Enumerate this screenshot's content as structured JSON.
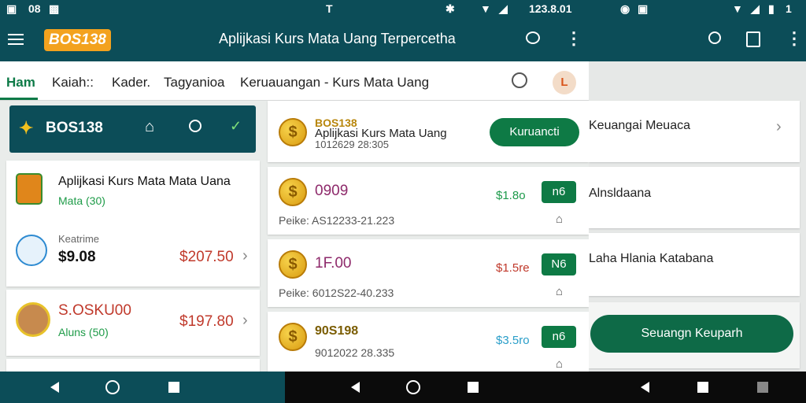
{
  "status_left": {
    "icons": [
      "n-icon",
      "photo-icon"
    ],
    "text": "08"
  },
  "status_mid": {
    "text": "T",
    "time": "123.8.01"
  },
  "status_right": {
    "text": "1"
  },
  "brand": {
    "logo_text": "BOS138"
  },
  "appbar": {
    "title": "Aplijkasi Kurs Mata Uang Terpercetha"
  },
  "tabs": [
    {
      "label": "Ham",
      "active": true
    },
    {
      "label": "Kaiah::"
    },
    {
      "label": "Kader."
    },
    {
      "label": "Tagyanioa"
    },
    {
      "label": "Keruauangan - Kurs Mata Uang"
    }
  ],
  "avatar_letter": "L",
  "panel_left": {
    "header_logo": "BOS138",
    "card1": {
      "title": "Aplijkasi Kurs Mata Mata Uana",
      "sub": "Mata (30)"
    },
    "card2": {
      "caption": "Keatrime",
      "value": "$9.08",
      "amount": "$207.50"
    },
    "card3": {
      "title": "S.OSKU00",
      "sub": "Aluns (50)",
      "amount": "$197.80"
    }
  },
  "panel_center": {
    "top": {
      "brand": "BOS138",
      "title": "Aplijkasi Kurs Mata Uang",
      "sub": "1012629 28:305",
      "button": "Kuruancti"
    },
    "rows": [
      {
        "name": "0909",
        "rate": "$1.8o",
        "badge": "n6",
        "pair": "Peike: AS12233-21.223",
        "rate_color": "#1d9a4b",
        "name_color": "#8e2a6b"
      },
      {
        "name": "1F.00",
        "rate": "$1.5re",
        "badge": "N6",
        "pair": "Peike: 6012S22-40.233",
        "rate_color": "#c0392b",
        "name_color": "#8e2a6b"
      },
      {
        "name": "90S198",
        "rate": "$3.5ro",
        "badge": "n6",
        "pair": "9012022 28.335",
        "rate_color": "#2a9ec9",
        "name_color": "#7a5c00"
      }
    ]
  },
  "side": {
    "items": [
      {
        "label": "Keuangai Meuaca"
      },
      {
        "label": "Alnsldaana"
      },
      {
        "label": "Laha Hlania Katabana"
      }
    ],
    "button": "Seuangn Keuparh"
  },
  "colors": {
    "teal": "#0c4d58",
    "green": "#0e7a45",
    "amount_red": "#c0392b"
  }
}
